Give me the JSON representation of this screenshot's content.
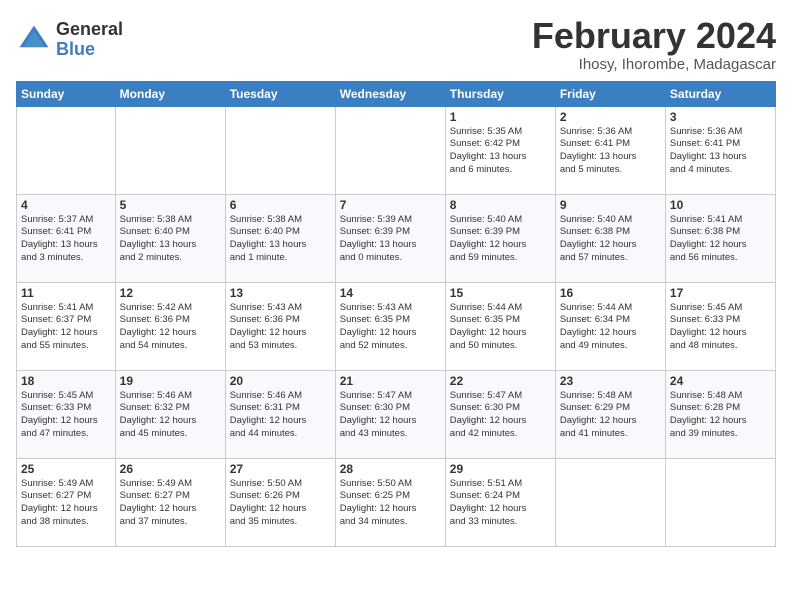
{
  "header": {
    "logo_general": "General",
    "logo_blue": "Blue",
    "month_title": "February 2024",
    "subtitle": "Ihosy, Ihorombe, Madagascar"
  },
  "days_of_week": [
    "Sunday",
    "Monday",
    "Tuesday",
    "Wednesday",
    "Thursday",
    "Friday",
    "Saturday"
  ],
  "weeks": [
    [
      {
        "num": "",
        "info": ""
      },
      {
        "num": "",
        "info": ""
      },
      {
        "num": "",
        "info": ""
      },
      {
        "num": "",
        "info": ""
      },
      {
        "num": "1",
        "info": "Sunrise: 5:35 AM\nSunset: 6:42 PM\nDaylight: 13 hours\nand 6 minutes."
      },
      {
        "num": "2",
        "info": "Sunrise: 5:36 AM\nSunset: 6:41 PM\nDaylight: 13 hours\nand 5 minutes."
      },
      {
        "num": "3",
        "info": "Sunrise: 5:36 AM\nSunset: 6:41 PM\nDaylight: 13 hours\nand 4 minutes."
      }
    ],
    [
      {
        "num": "4",
        "info": "Sunrise: 5:37 AM\nSunset: 6:41 PM\nDaylight: 13 hours\nand 3 minutes."
      },
      {
        "num": "5",
        "info": "Sunrise: 5:38 AM\nSunset: 6:40 PM\nDaylight: 13 hours\nand 2 minutes."
      },
      {
        "num": "6",
        "info": "Sunrise: 5:38 AM\nSunset: 6:40 PM\nDaylight: 13 hours\nand 1 minute."
      },
      {
        "num": "7",
        "info": "Sunrise: 5:39 AM\nSunset: 6:39 PM\nDaylight: 13 hours\nand 0 minutes."
      },
      {
        "num": "8",
        "info": "Sunrise: 5:40 AM\nSunset: 6:39 PM\nDaylight: 12 hours\nand 59 minutes."
      },
      {
        "num": "9",
        "info": "Sunrise: 5:40 AM\nSunset: 6:38 PM\nDaylight: 12 hours\nand 57 minutes."
      },
      {
        "num": "10",
        "info": "Sunrise: 5:41 AM\nSunset: 6:38 PM\nDaylight: 12 hours\nand 56 minutes."
      }
    ],
    [
      {
        "num": "11",
        "info": "Sunrise: 5:41 AM\nSunset: 6:37 PM\nDaylight: 12 hours\nand 55 minutes."
      },
      {
        "num": "12",
        "info": "Sunrise: 5:42 AM\nSunset: 6:36 PM\nDaylight: 12 hours\nand 54 minutes."
      },
      {
        "num": "13",
        "info": "Sunrise: 5:43 AM\nSunset: 6:36 PM\nDaylight: 12 hours\nand 53 minutes."
      },
      {
        "num": "14",
        "info": "Sunrise: 5:43 AM\nSunset: 6:35 PM\nDaylight: 12 hours\nand 52 minutes."
      },
      {
        "num": "15",
        "info": "Sunrise: 5:44 AM\nSunset: 6:35 PM\nDaylight: 12 hours\nand 50 minutes."
      },
      {
        "num": "16",
        "info": "Sunrise: 5:44 AM\nSunset: 6:34 PM\nDaylight: 12 hours\nand 49 minutes."
      },
      {
        "num": "17",
        "info": "Sunrise: 5:45 AM\nSunset: 6:33 PM\nDaylight: 12 hours\nand 48 minutes."
      }
    ],
    [
      {
        "num": "18",
        "info": "Sunrise: 5:45 AM\nSunset: 6:33 PM\nDaylight: 12 hours\nand 47 minutes."
      },
      {
        "num": "19",
        "info": "Sunrise: 5:46 AM\nSunset: 6:32 PM\nDaylight: 12 hours\nand 45 minutes."
      },
      {
        "num": "20",
        "info": "Sunrise: 5:46 AM\nSunset: 6:31 PM\nDaylight: 12 hours\nand 44 minutes."
      },
      {
        "num": "21",
        "info": "Sunrise: 5:47 AM\nSunset: 6:30 PM\nDaylight: 12 hours\nand 43 minutes."
      },
      {
        "num": "22",
        "info": "Sunrise: 5:47 AM\nSunset: 6:30 PM\nDaylight: 12 hours\nand 42 minutes."
      },
      {
        "num": "23",
        "info": "Sunrise: 5:48 AM\nSunset: 6:29 PM\nDaylight: 12 hours\nand 41 minutes."
      },
      {
        "num": "24",
        "info": "Sunrise: 5:48 AM\nSunset: 6:28 PM\nDaylight: 12 hours\nand 39 minutes."
      }
    ],
    [
      {
        "num": "25",
        "info": "Sunrise: 5:49 AM\nSunset: 6:27 PM\nDaylight: 12 hours\nand 38 minutes."
      },
      {
        "num": "26",
        "info": "Sunrise: 5:49 AM\nSunset: 6:27 PM\nDaylight: 12 hours\nand 37 minutes."
      },
      {
        "num": "27",
        "info": "Sunrise: 5:50 AM\nSunset: 6:26 PM\nDaylight: 12 hours\nand 35 minutes."
      },
      {
        "num": "28",
        "info": "Sunrise: 5:50 AM\nSunset: 6:25 PM\nDaylight: 12 hours\nand 34 minutes."
      },
      {
        "num": "29",
        "info": "Sunrise: 5:51 AM\nSunset: 6:24 PM\nDaylight: 12 hours\nand 33 minutes."
      },
      {
        "num": "",
        "info": ""
      },
      {
        "num": "",
        "info": ""
      }
    ]
  ]
}
